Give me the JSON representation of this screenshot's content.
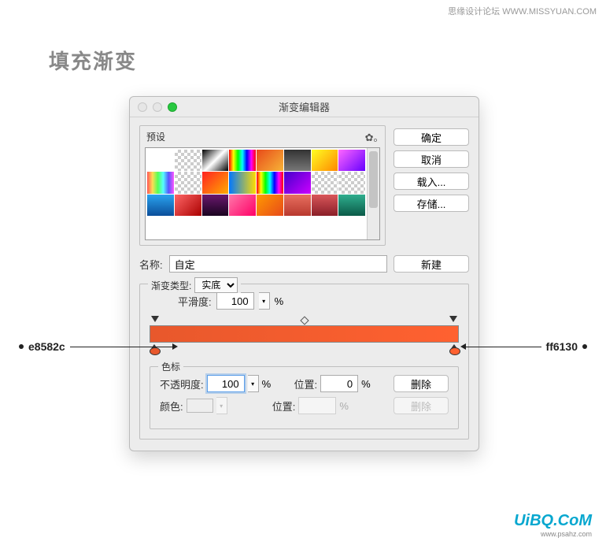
{
  "watermarks": {
    "top": "思缘设计论坛  WWW.MISSYUAN.COM",
    "bottom_main": "UiBQ.CoM",
    "bottom_sub": "www.psahz.com"
  },
  "page_title": "填充渐变",
  "dialog": {
    "title": "渐变编辑器",
    "presets_label": "预设",
    "buttons": {
      "ok": "确定",
      "cancel": "取消",
      "load": "载入...",
      "save": "存储...",
      "new": "新建",
      "delete": "删除"
    },
    "name_label": "名称:",
    "name_value": "自定",
    "gradient_type_label": "渐变类型:",
    "gradient_type_value": "实底",
    "smoothness_label": "平滑度:",
    "smoothness_value": "100",
    "percent": "%",
    "stops_label": "色标",
    "opacity_label": "不透明度:",
    "opacity_value": "100",
    "location_label": "位置:",
    "location_value": "0",
    "color_label": "颜色:",
    "gradient": {
      "left_color": "#e8582c",
      "right_color": "#ff6130"
    }
  },
  "annotations": {
    "left": "e8582c",
    "right": "ff6130"
  },
  "preset_swatches": [
    "#ffffff",
    "checker",
    "linear-gradient(135deg,#000,#fff,#000)",
    "linear-gradient(90deg,red,#ff0,#0f0,#0ff,#00f,#f0f,red)",
    "linear-gradient(135deg,#e84a1a,#f7b437)",
    "linear-gradient(180deg,#333,#777)",
    "linear-gradient(135deg,#ff2,#f80)",
    "linear-gradient(135deg,#f6f,#60f)",
    "linear-gradient(90deg,#f55,#fd5,#5f5,#5ff,#55f,#f5f)",
    "checker",
    "linear-gradient(135deg,#f22,#fa0)",
    "linear-gradient(90deg,#07f,#fd0)",
    "linear-gradient(90deg,red,#ff0,#0f0,#0ff,#00f,#f0f,red)",
    "linear-gradient(135deg,#40c,#c0f)",
    "checker",
    "checker",
    "linear-gradient(180deg,#2aa3ef,#0b4e9a)",
    "linear-gradient(135deg,#f66,#a00)",
    "linear-gradient(180deg,#6a176e,#1a0420)",
    "linear-gradient(135deg,#f7a,#f06)",
    "linear-gradient(135deg,#f90,#e84a1a)",
    "linear-gradient(180deg,#e87060,#b8382e)",
    "linear-gradient(180deg,#d9565a,#8a1f28)",
    "linear-gradient(180deg,#2fae8e,#0b5a48)"
  ]
}
